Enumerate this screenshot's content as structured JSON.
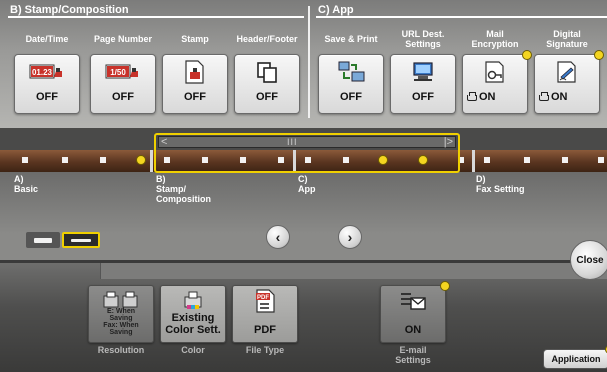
{
  "section_b": {
    "title": "B)  Stamp/Composition",
    "functions": [
      {
        "label": "Date/Time",
        "value": "OFF",
        "icon": "date-time-icon",
        "icon_text": "01.23"
      },
      {
        "label": "Page Number",
        "value": "OFF",
        "icon": "page-number-icon",
        "icon_text": "1/50"
      },
      {
        "label": "Stamp",
        "value": "OFF",
        "icon": "stamp-icon"
      },
      {
        "label": "Header/Footer",
        "value": "OFF",
        "icon": "header-footer-icon"
      }
    ]
  },
  "section_c": {
    "title": "C)  App",
    "functions": [
      {
        "label": "Save & Print",
        "value": "OFF",
        "icon": "save-print-icon"
      },
      {
        "label": "URL Dest.\nSettings",
        "value": "OFF",
        "icon": "url-dest-icon"
      },
      {
        "label": "Mail\nEncryption",
        "value": "ON",
        "icon": "mail-encryption-icon"
      },
      {
        "label": "Digital\nSignature",
        "value": "ON",
        "icon": "digital-signature-icon"
      }
    ]
  },
  "pages": [
    {
      "label": "A)\nBasic"
    },
    {
      "label": "B)\nStamp/\nComposition"
    },
    {
      "label": "C)\nApp"
    },
    {
      "label": "D)\nFax Setting"
    }
  ],
  "scrollbar": {
    "left_arrow": "<",
    "right_arrow": "|>",
    "grip": "III"
  },
  "nav": {
    "prev": "‹",
    "next": "›"
  },
  "close_label": "Close",
  "application_label": "Application",
  "bottom_functions": [
    {
      "caption": "Resolution",
      "value": "E: When\nSaving\nFax: When\nSaving",
      "icon": "resolution-icon"
    },
    {
      "caption": "Color",
      "value": "Existing\nColor Sett.",
      "icon": "color-icon"
    },
    {
      "caption": "File Type",
      "value": "PDF",
      "icon": "pdf-file-icon",
      "icon_text": "PDF"
    },
    {
      "caption": "E-mail\nSettings",
      "value": "ON",
      "icon": "email-settings-icon"
    }
  ],
  "colors": {
    "highlight": "#f0d000",
    "indicator": "#f4d520",
    "strip": "#5a3520"
  }
}
